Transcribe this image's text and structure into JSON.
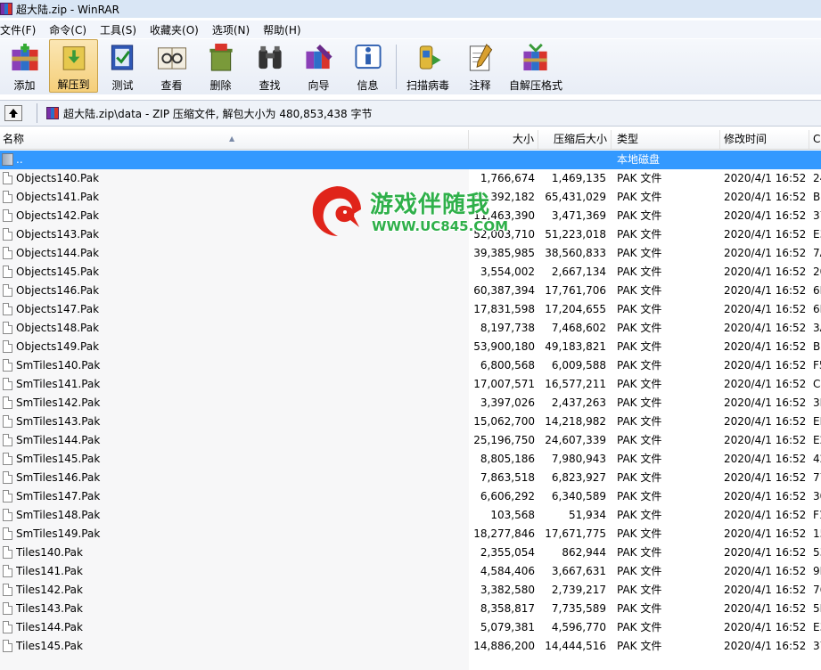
{
  "window": {
    "title": "超大陆.zip - WinRAR"
  },
  "menu": [
    "文件(F)",
    "命令(C)",
    "工具(S)",
    "收藏夹(O)",
    "选项(N)",
    "帮助(H)"
  ],
  "toolbar": [
    {
      "label": "添加",
      "icon": "add-icon"
    },
    {
      "label": "解压到",
      "icon": "extract-icon",
      "active": true
    },
    {
      "label": "测试",
      "icon": "test-icon"
    },
    {
      "label": "查看",
      "icon": "view-icon"
    },
    {
      "label": "删除",
      "icon": "delete-icon"
    },
    {
      "label": "查找",
      "icon": "find-icon"
    },
    {
      "label": "向导",
      "icon": "wizard-icon"
    },
    {
      "label": "信息",
      "icon": "info-icon"
    },
    {
      "label": "扫描病毒",
      "icon": "virus-scan-icon"
    },
    {
      "label": "注释",
      "icon": "comment-icon"
    },
    {
      "label": "自解压格式",
      "icon": "sfx-icon"
    }
  ],
  "address": {
    "text": "超大陆.zip\\data - ZIP 压缩文件, 解包大小为 480,853,438 字节"
  },
  "columns": {
    "name": "名称",
    "size": "大小",
    "packed": "压缩后大小",
    "type": "类型",
    "mtime": "修改时间",
    "crc": "C"
  },
  "parent_row": {
    "name": "..",
    "type": "本地磁盘"
  },
  "files": [
    {
      "name": "Objects140.Pak",
      "size": "1,766,674",
      "packed": "1,469,135",
      "type": "PAK 文件",
      "mtime": "2020/4/1 16:52",
      "crc": "24"
    },
    {
      "name": "Objects141.Pak",
      "size": "66,392,182",
      "packed": "65,431,029",
      "type": "PAK 文件",
      "mtime": "2020/4/1 16:52",
      "crc": "B"
    },
    {
      "name": "Objects142.Pak",
      "size": "11,463,390",
      "packed": "3,471,369",
      "type": "PAK 文件",
      "mtime": "2020/4/1 16:52",
      "crc": "37"
    },
    {
      "name": "Objects143.Pak",
      "size": "52,003,710",
      "packed": "51,223,018",
      "type": "PAK 文件",
      "mtime": "2020/4/1 16:52",
      "crc": "E3"
    },
    {
      "name": "Objects144.Pak",
      "size": "39,385,985",
      "packed": "38,560,833",
      "type": "PAK 文件",
      "mtime": "2020/4/1 16:52",
      "crc": "7A"
    },
    {
      "name": "Objects145.Pak",
      "size": "3,554,002",
      "packed": "2,667,134",
      "type": "PAK 文件",
      "mtime": "2020/4/1 16:52",
      "crc": "20"
    },
    {
      "name": "Objects146.Pak",
      "size": "60,387,394",
      "packed": "17,761,706",
      "type": "PAK 文件",
      "mtime": "2020/4/1 16:52",
      "crc": "6B"
    },
    {
      "name": "Objects147.Pak",
      "size": "17,831,598",
      "packed": "17,204,655",
      "type": "PAK 文件",
      "mtime": "2020/4/1 16:52",
      "crc": "6B"
    },
    {
      "name": "Objects148.Pak",
      "size": "8,197,738",
      "packed": "7,468,602",
      "type": "PAK 文件",
      "mtime": "2020/4/1 16:52",
      "crc": "3A"
    },
    {
      "name": "Objects149.Pak",
      "size": "53,900,180",
      "packed": "49,183,821",
      "type": "PAK 文件",
      "mtime": "2020/4/1 16:52",
      "crc": "B"
    },
    {
      "name": "SmTiles140.Pak",
      "size": "6,800,568",
      "packed": "6,009,588",
      "type": "PAK 文件",
      "mtime": "2020/4/1 16:52",
      "crc": "F5"
    },
    {
      "name": "SmTiles141.Pak",
      "size": "17,007,571",
      "packed": "16,577,211",
      "type": "PAK 文件",
      "mtime": "2020/4/1 16:52",
      "crc": "C4"
    },
    {
      "name": "SmTiles142.Pak",
      "size": "3,397,026",
      "packed": "2,437,263",
      "type": "PAK 文件",
      "mtime": "2020/4/1 16:52",
      "crc": "3E"
    },
    {
      "name": "SmTiles143.Pak",
      "size": "15,062,700",
      "packed": "14,218,982",
      "type": "PAK 文件",
      "mtime": "2020/4/1 16:52",
      "crc": "EI"
    },
    {
      "name": "SmTiles144.Pak",
      "size": "25,196,750",
      "packed": "24,607,339",
      "type": "PAK 文件",
      "mtime": "2020/4/1 16:52",
      "crc": "E2"
    },
    {
      "name": "SmTiles145.Pak",
      "size": "8,805,186",
      "packed": "7,980,943",
      "type": "PAK 文件",
      "mtime": "2020/4/1 16:52",
      "crc": "42"
    },
    {
      "name": "SmTiles146.Pak",
      "size": "7,863,518",
      "packed": "6,823,927",
      "type": "PAK 文件",
      "mtime": "2020/4/1 16:52",
      "crc": "77"
    },
    {
      "name": "SmTiles147.Pak",
      "size": "6,606,292",
      "packed": "6,340,589",
      "type": "PAK 文件",
      "mtime": "2020/4/1 16:52",
      "crc": "30"
    },
    {
      "name": "SmTiles148.Pak",
      "size": "103,568",
      "packed": "51,934",
      "type": "PAK 文件",
      "mtime": "2020/4/1 16:52",
      "crc": "F1"
    },
    {
      "name": "SmTiles149.Pak",
      "size": "18,277,846",
      "packed": "17,671,775",
      "type": "PAK 文件",
      "mtime": "2020/4/1 16:52",
      "crc": "15"
    },
    {
      "name": "Tiles140.Pak",
      "size": "2,355,054",
      "packed": "862,944",
      "type": "PAK 文件",
      "mtime": "2020/4/1 16:52",
      "crc": "53"
    },
    {
      "name": "Tiles141.Pak",
      "size": "4,584,406",
      "packed": "3,667,631",
      "type": "PAK 文件",
      "mtime": "2020/4/1 16:52",
      "crc": "9I"
    },
    {
      "name": "Tiles142.Pak",
      "size": "3,382,580",
      "packed": "2,739,217",
      "type": "PAK 文件",
      "mtime": "2020/4/1 16:52",
      "crc": "76"
    },
    {
      "name": "Tiles143.Pak",
      "size": "8,358,817",
      "packed": "7,735,589",
      "type": "PAK 文件",
      "mtime": "2020/4/1 16:52",
      "crc": "5E"
    },
    {
      "name": "Tiles144.Pak",
      "size": "5,079,381",
      "packed": "4,596,770",
      "type": "PAK 文件",
      "mtime": "2020/4/1 16:52",
      "crc": "E3"
    },
    {
      "name": "Tiles145.Pak",
      "size": "14,886,200",
      "packed": "14,444,516",
      "type": "PAK 文件",
      "mtime": "2020/4/1 16:52",
      "crc": "37"
    }
  ],
  "watermark": {
    "title": "游戏伴随我",
    "url": "WWW.UC845.COM"
  }
}
